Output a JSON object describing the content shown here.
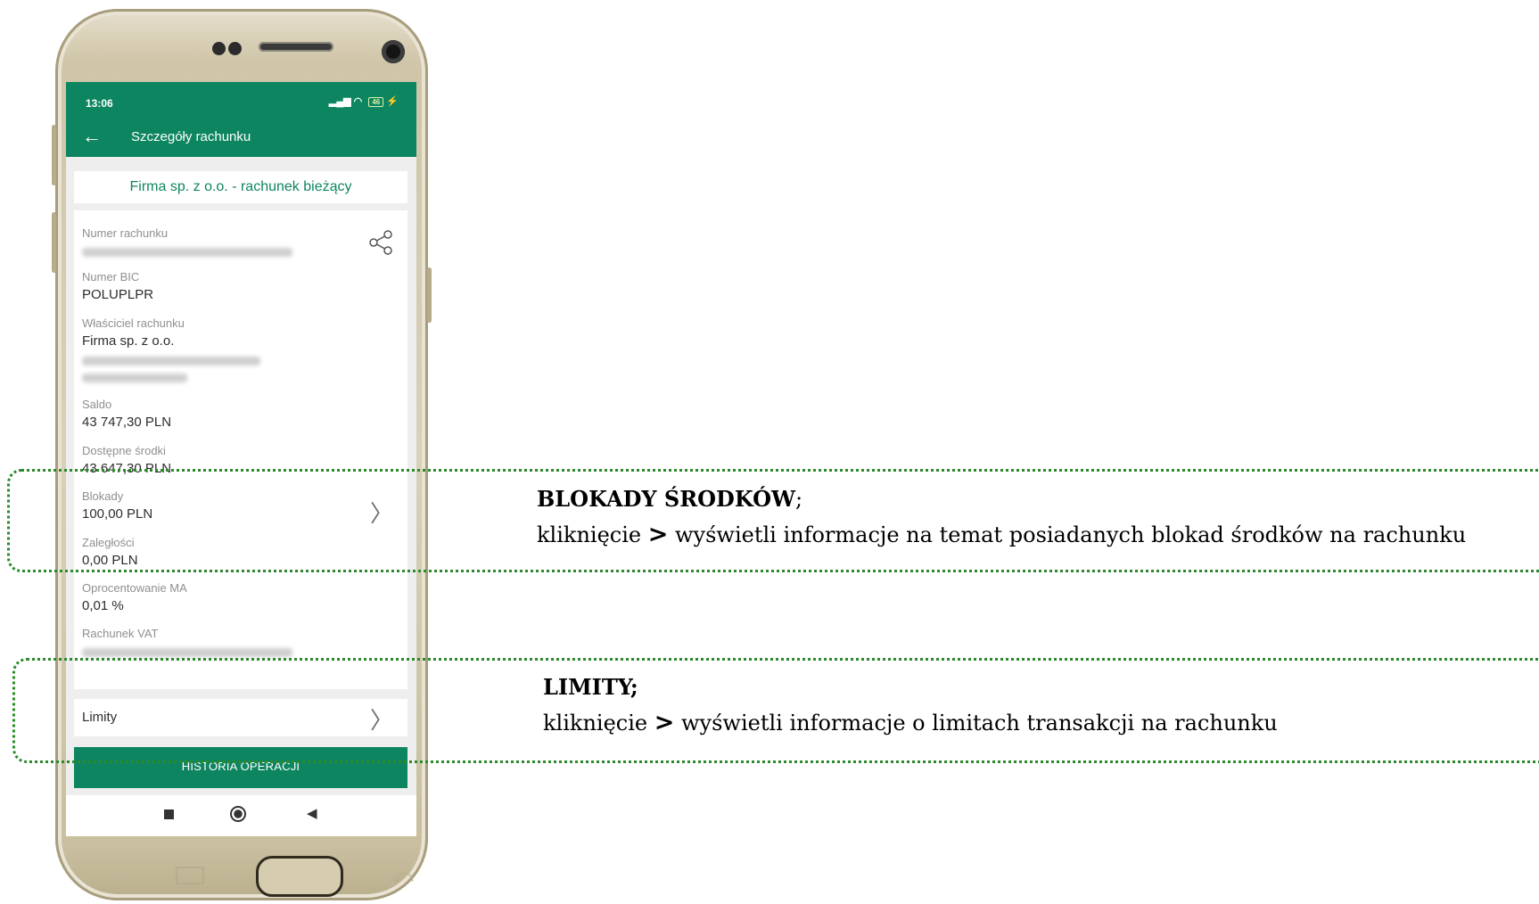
{
  "statusbar": {
    "time": "13:06",
    "battery": "46"
  },
  "appbar": {
    "title": "Szczegóły rachunku"
  },
  "account": {
    "name": "Firma sp. z o.o. - rachunek bieżący",
    "fields": {
      "numer_rachunku": {
        "label": "Numer rachunku"
      },
      "bic": {
        "label": "Numer BIC",
        "value": "POLUPLPR"
      },
      "wlasciciel": {
        "label": "Właściciel rachunku",
        "value": "Firma sp. z o.o."
      },
      "saldo": {
        "label": "Saldo",
        "value": "43 747,30 PLN"
      },
      "dostepne": {
        "label": "Dostępne środki",
        "value": "43 647,30 PLN"
      },
      "blokady": {
        "label": "Blokady",
        "value": "100,00 PLN"
      },
      "zaleglosci": {
        "label": "Zaległości",
        "value": "0,00 PLN"
      },
      "oprocentowanie": {
        "label": "Oprocentowanie MA",
        "value": "0,01 %"
      },
      "vat": {
        "label": "Rachunek VAT"
      }
    }
  },
  "limity": {
    "label": "Limity"
  },
  "history_button": {
    "label": "HISTORIA OPERACJI"
  },
  "annotations": {
    "blokady": {
      "heading": "BLOKADY ŚRODKÓW",
      "heading_suffix": ";",
      "text_prefix": "kliknięcie ",
      "symbol": ">",
      "text_suffix": " wyświetli informacje na temat posiadanych blokad środków na rachunku"
    },
    "limity": {
      "heading": "LIMITY;",
      "text_prefix": "kliknięcie ",
      "symbol": ">",
      "text_suffix": " wyświetli informacje o limitach transakcji na rachunku"
    }
  },
  "colors": {
    "brand_green": "#0e8561",
    "highlight_frame": "#2b8a2b"
  }
}
